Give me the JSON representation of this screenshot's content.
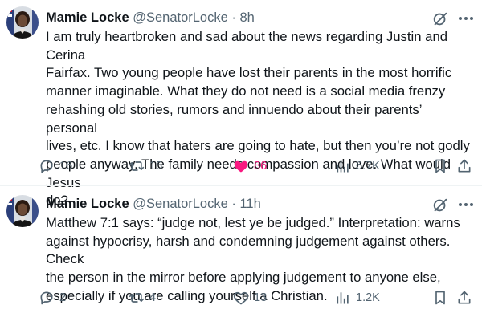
{
  "tweets": [
    {
      "name": "Mamie Locke",
      "handle": "@SenatorLocke",
      "separator": "·",
      "time": "8h",
      "text": "I am truly heartbroken and sad about the news regarding Justin and Cerina\nFairfax.  Two young people have lost their parents in the most horrific\nmanner imaginable.  What they do not need is a social media frenzy\nrehashing old stories, rumors and innuendo about their parents’ personal\nlives, etc.  I know that haters are going to hate, but then you’re not godly\npeople anyway.  The family needs compassion and love.  What would Jesus\ndo?",
      "replies": "16",
      "reposts": "15",
      "likes": "86",
      "views": "6.7K",
      "liked": true
    },
    {
      "name": "Mamie Locke",
      "handle": "@SenatorLocke",
      "separator": "·",
      "time": "11h",
      "text": "Matthew 7:1 says: “judge not, lest ye be judged.”  Interpretation:  warns\nagainst hypocrisy, harsh and condemning judgement against others. Check\nthe person in the mirror before applying judgement to anyone else,\nespecially if you are calling yourself a Christian.",
      "replies": "2",
      "reposts": "4",
      "likes": "13",
      "views": "1.2K",
      "liked": false
    }
  ],
  "icons": {
    "reply": "reply-icon",
    "repost": "repost-icon",
    "like": "heart-icon",
    "views": "views-icon",
    "bookmark": "bookmark-icon",
    "share": "share-icon",
    "grok": "grok-icon",
    "more": "more-icon"
  },
  "colors": {
    "text": "#0f1419",
    "secondary": "#536471",
    "like_active": "#f91880",
    "divider": "#eff3f4"
  }
}
